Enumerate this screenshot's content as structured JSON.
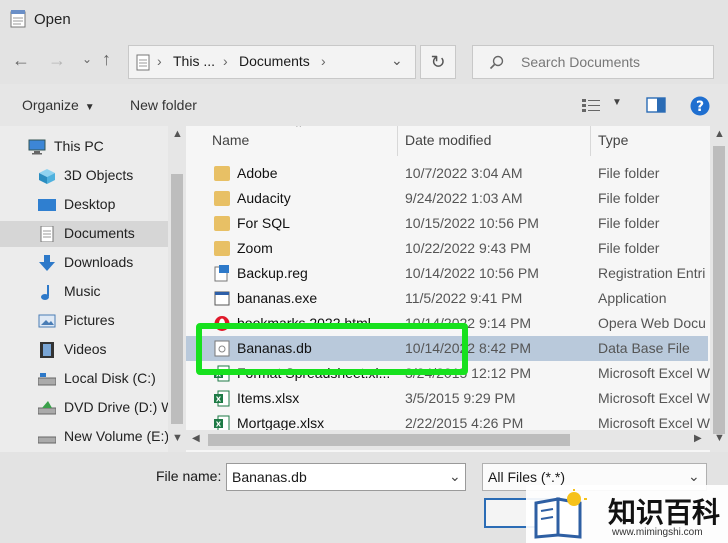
{
  "window": {
    "title": "Open"
  },
  "address": {
    "crumb1": "This ...",
    "crumb2": "Documents"
  },
  "search": {
    "placeholder": "Search Documents"
  },
  "toolbar": {
    "organize": "Organize",
    "new_folder": "New folder"
  },
  "sidebar": {
    "items": [
      {
        "label": "This PC",
        "icon": "computer-icon"
      },
      {
        "label": "3D Objects",
        "icon": "cube-icon"
      },
      {
        "label": "Desktop",
        "icon": "desktop-icon"
      },
      {
        "label": "Documents",
        "icon": "document-icon",
        "selected": true
      },
      {
        "label": "Downloads",
        "icon": "download-arrow-icon"
      },
      {
        "label": "Music",
        "icon": "music-note-icon"
      },
      {
        "label": "Pictures",
        "icon": "pictures-icon"
      },
      {
        "label": "Videos",
        "icon": "film-icon"
      },
      {
        "label": "Local Disk (C:)",
        "icon": "drive-icon"
      },
      {
        "label": "DVD Drive (D:) W",
        "icon": "dvd-icon"
      },
      {
        "label": "New Volume (E:)",
        "icon": "drive-icon"
      }
    ]
  },
  "columns": {
    "name": "Name",
    "date": "Date modified",
    "type": "Type"
  },
  "files": [
    {
      "name": "Adobe",
      "date": "10/7/2022 3:04 AM",
      "type": "File folder",
      "icon": "folder-icon"
    },
    {
      "name": "Audacity",
      "date": "9/24/2022 1:03 AM",
      "type": "File folder",
      "icon": "folder-icon"
    },
    {
      "name": "For SQL",
      "date": "10/15/2022 10:56 PM",
      "type": "File folder",
      "icon": "folder-icon"
    },
    {
      "name": "Zoom",
      "date": "10/22/2022 9:43 PM",
      "type": "File folder",
      "icon": "folder-icon"
    },
    {
      "name": "Backup.reg",
      "date": "10/14/2022 10:56 PM",
      "type": "Registration Entri",
      "icon": "registry-icon"
    },
    {
      "name": "bananas.exe",
      "date": "11/5/2022 9:41 PM",
      "type": "Application",
      "icon": "app-icon"
    },
    {
      "name": "bookmarks 2022.html",
      "date": "10/14/2022 9:14 PM",
      "type": "Opera Web Docu",
      "icon": "opera-icon"
    },
    {
      "name": "Bananas.db",
      "date": "10/14/2022 8:42 PM",
      "type": "Data Base File",
      "icon": "database-file-icon",
      "selected": true
    },
    {
      "name": "Format Spreadsheet.xl...",
      "date": "3/24/2015 12:12 PM",
      "type": "Microsoft Excel W",
      "icon": "excel-icon"
    },
    {
      "name": "Items.xlsx",
      "date": "3/5/2015 9:29 PM",
      "type": "Microsoft Excel W",
      "icon": "excel-icon"
    },
    {
      "name": "Mortgage.xlsx",
      "date": "2/22/2015 4:26 PM",
      "type": "Microsoft Excel W",
      "icon": "excel-icon"
    }
  ],
  "footer": {
    "file_name_label": "File name:",
    "file_name_value": "Bananas.db",
    "file_type": "All Files (*.*)"
  },
  "watermark": {
    "cn": "知识百科",
    "url": "www.mimingshi.com"
  },
  "colors": {
    "highlight": "#17e11e",
    "selected_row": "#b9c9db",
    "folder": "#e8c065"
  }
}
